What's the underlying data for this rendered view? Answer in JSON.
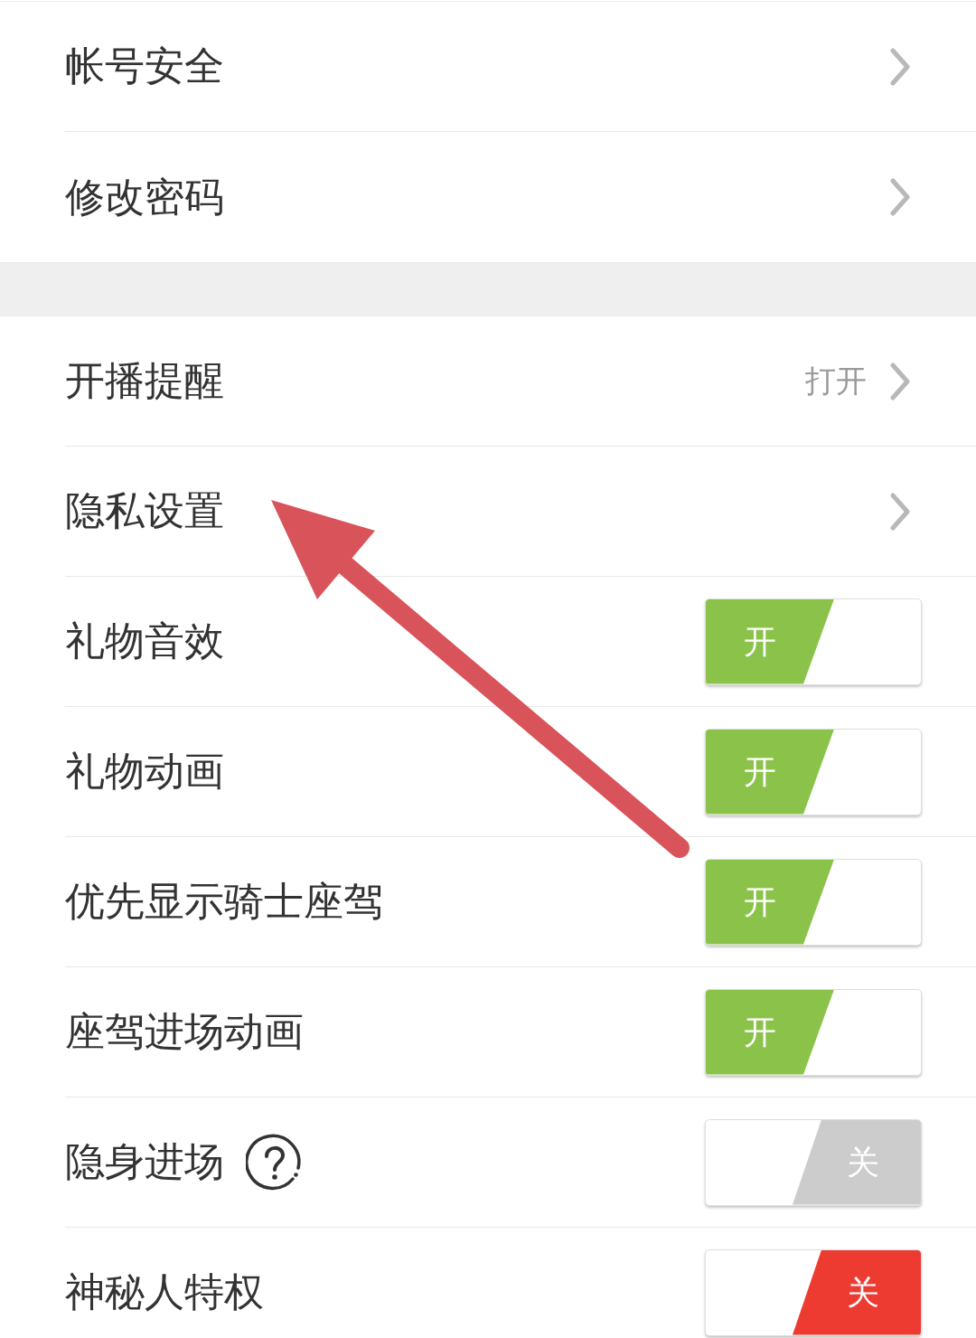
{
  "sections": [
    {
      "rows": [
        {
          "kind": "link",
          "label": "帐号安全"
        },
        {
          "kind": "link",
          "label": "修改密码"
        }
      ]
    },
    {
      "rows": [
        {
          "kind": "link",
          "label": "开播提醒",
          "value": "打开"
        },
        {
          "kind": "link",
          "label": "隐私设置"
        },
        {
          "kind": "toggle",
          "label": "礼物音效",
          "on": true,
          "switch_label": "开",
          "color": "#8bc34a"
        },
        {
          "kind": "toggle",
          "label": "礼物动画",
          "on": true,
          "switch_label": "开",
          "color": "#8bc34a"
        },
        {
          "kind": "toggle",
          "label": "优先显示骑士座驾",
          "on": true,
          "switch_label": "开",
          "color": "#8bc34a"
        },
        {
          "kind": "toggle",
          "label": "座驾进场动画",
          "on": true,
          "switch_label": "开",
          "color": "#8bc34a"
        },
        {
          "kind": "toggle",
          "label": "隐身进场",
          "help": true,
          "on": false,
          "switch_label": "关",
          "color": "#cccccc"
        },
        {
          "kind": "toggle",
          "label": "神秘人特权",
          "on": false,
          "switch_label": "关",
          "color": "#ee3b32"
        }
      ]
    }
  ],
  "annotation": {
    "kind": "arrow",
    "color": "#d9545a"
  }
}
